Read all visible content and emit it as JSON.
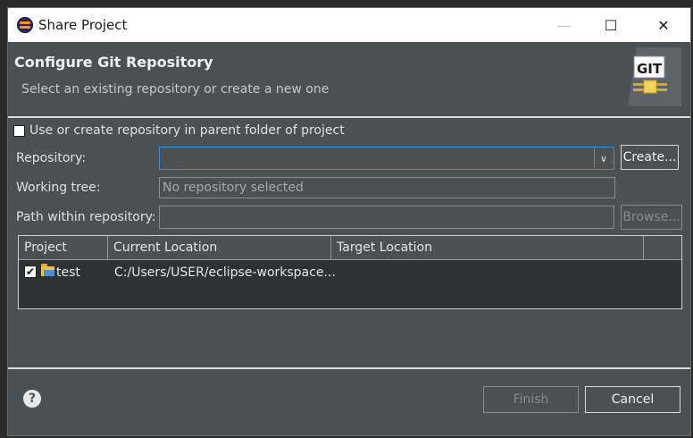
{
  "window": {
    "title": "Share Project",
    "minimize_glyph": "—",
    "maximize_glyph": "☐",
    "close_glyph": "✕"
  },
  "header": {
    "title": "Configure Git Repository",
    "subtitle": "Select an existing repository or create a new one",
    "logo_text": "GIT"
  },
  "form": {
    "use_parent_label": "Use or create repository in parent folder of project",
    "use_parent_checked": false,
    "repository_label": "Repository:",
    "repository_value": "",
    "create_button": "Create...",
    "working_tree_label": "Working tree:",
    "working_tree_value": "No repository selected",
    "path_label": "Path within repository:",
    "path_value": "",
    "browse_button": "Browse..."
  },
  "table": {
    "columns": [
      "Project",
      "Current Location",
      "Target Location"
    ],
    "rows": [
      {
        "checked": true,
        "project": "test",
        "current_location": "C:/Users/USER/eclipse-workspace...",
        "target_location": ""
      }
    ]
  },
  "footer": {
    "help_glyph": "?",
    "finish_button": "Finish",
    "cancel_button": "Cancel"
  },
  "colors": {
    "dialog_bg": "#4b5053",
    "focus_border": "#3c8ee0",
    "table_bg": "#2f3133"
  }
}
